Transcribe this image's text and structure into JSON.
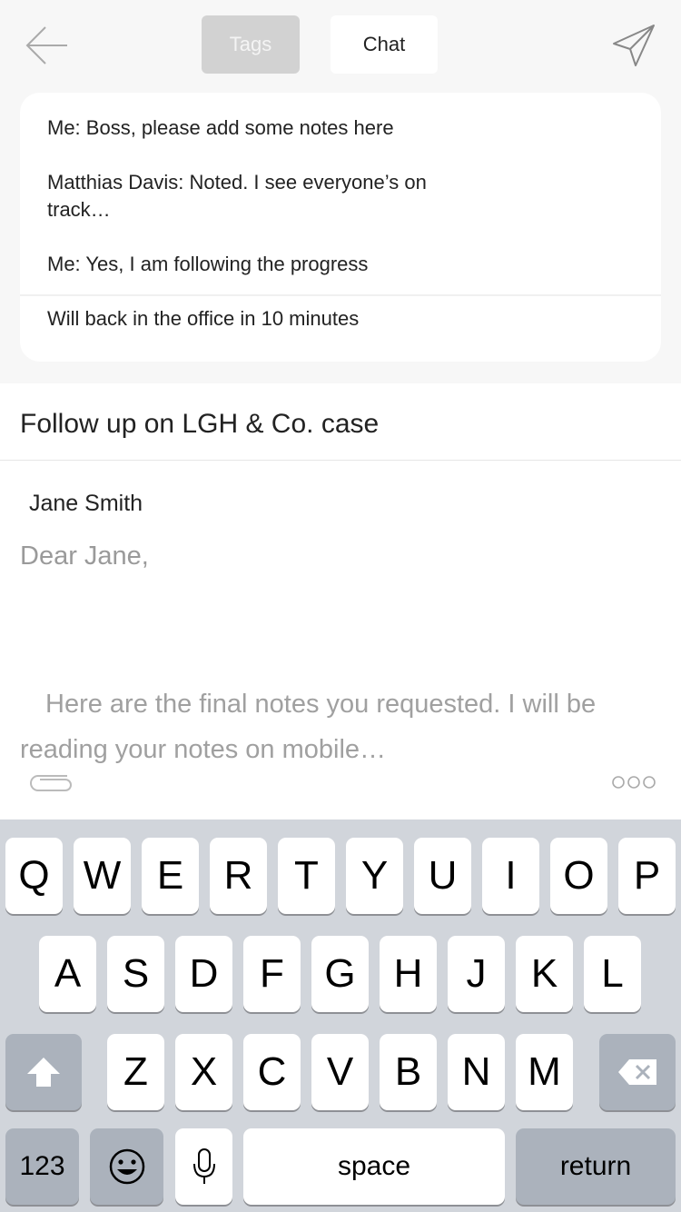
{
  "header": {
    "tabs": [
      {
        "label": "Tags",
        "active": false
      },
      {
        "label": "Chat",
        "active": true
      }
    ]
  },
  "chat": {
    "messages": [
      "Me: Boss, please add some notes here",
      "Matthias Davis: Noted. I see everyone’s on track…",
      "Me: Yes, I am following the progress",
      "Will back in the office in 10 minutes"
    ]
  },
  "compose": {
    "subject": "Follow up on LGH & Co. case",
    "recipient": "Jane Smith",
    "greeting": "Dear Jane,",
    "body": "Here are the final notes you requested. I will be reading your notes on mobile…"
  },
  "keyboard": {
    "row1": [
      "Q",
      "W",
      "E",
      "R",
      "T",
      "Y",
      "U",
      "I",
      "O",
      "P"
    ],
    "row2": [
      "A",
      "S",
      "D",
      "F",
      "G",
      "H",
      "J",
      "K",
      "L"
    ],
    "row3": [
      "Z",
      "X",
      "C",
      "V",
      "B",
      "N",
      "M"
    ],
    "numbers_label": "123",
    "space_label": "space",
    "return_label": "return"
  },
  "colors": {
    "background": "#f7f7f7",
    "keyboard_bg": "#d1d5db",
    "function_key": "#abb2bc",
    "tab_inactive": "#d2d2d2"
  },
  "icons": [
    "back-arrow-icon",
    "send-paper-plane-icon",
    "paperclip-icon",
    "more-dots-icon",
    "shift-icon",
    "delete-icon",
    "emoji-icon",
    "microphone-icon"
  ]
}
